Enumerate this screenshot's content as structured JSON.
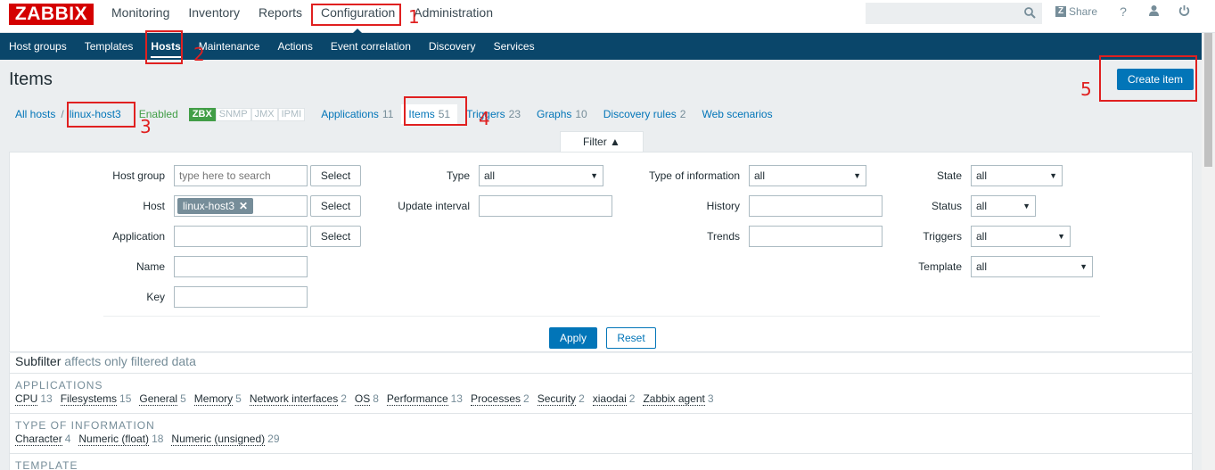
{
  "topbar": {
    "logo": "ZABBIX",
    "nav": [
      "Monitoring",
      "Inventory",
      "Reports",
      "Configuration",
      "Administration"
    ],
    "share": "Share",
    "help": "?",
    "icons": [
      "search-icon",
      "user-icon",
      "power-icon"
    ]
  },
  "subnav": [
    "Host groups",
    "Templates",
    "Hosts",
    "Maintenance",
    "Actions",
    "Event correlation",
    "Discovery",
    "Services"
  ],
  "page": {
    "title": "Items",
    "create_button": "Create item"
  },
  "breadcrumb": {
    "all_hosts": "All hosts",
    "separator": "/",
    "host": "linux-host3",
    "status": "Enabled",
    "badges": [
      {
        "label": "ZBX",
        "active": true
      },
      {
        "label": "SNMP",
        "active": false
      },
      {
        "label": "JMX",
        "active": false
      },
      {
        "label": "IPMI",
        "active": false
      }
    ],
    "tabs": [
      {
        "label": "Applications",
        "count": "11"
      },
      {
        "label": "Items",
        "count": "51"
      },
      {
        "label": "Triggers",
        "count": "23"
      },
      {
        "label": "Graphs",
        "count": "10"
      },
      {
        "label": "Discovery rules",
        "count": "2"
      },
      {
        "label": "Web scenarios",
        "count": ""
      }
    ]
  },
  "filter": {
    "tab_label": "Filter ▲",
    "host_group_label": "Host group",
    "host_group_placeholder": "type here to search",
    "host_label": "Host",
    "host_chip": "linux-host3",
    "application_label": "Application",
    "name_label": "Name",
    "key_label": "Key",
    "select_label": "Select",
    "type_label": "Type",
    "type_value": "all",
    "update_interval_label": "Update interval",
    "type_info_label": "Type of information",
    "type_info_value": "all",
    "history_label": "History",
    "trends_label": "Trends",
    "state_label": "State",
    "state_value": "all",
    "status_label": "Status",
    "status_value": "all",
    "triggers_label": "Triggers",
    "triggers_value": "all",
    "template_label": "Template",
    "template_value": "all",
    "apply": "Apply",
    "reset": "Reset"
  },
  "subfilter": {
    "title": "Subfilter",
    "note": "affects only filtered data",
    "applications": {
      "head": "APPLICATIONS",
      "items": [
        {
          "name": "CPU",
          "count": "13"
        },
        {
          "name": "Filesystems",
          "count": "15"
        },
        {
          "name": "General",
          "count": "5"
        },
        {
          "name": "Memory",
          "count": "5"
        },
        {
          "name": "Network interfaces",
          "count": "2"
        },
        {
          "name": "OS",
          "count": "8"
        },
        {
          "name": "Performance",
          "count": "13"
        },
        {
          "name": "Processes",
          "count": "2"
        },
        {
          "name": "Security",
          "count": "2"
        },
        {
          "name": "xiaodai",
          "count": "2"
        },
        {
          "name": "Zabbix agent",
          "count": "3"
        }
      ]
    },
    "type_of_information": {
      "head": "TYPE OF INFORMATION",
      "items": [
        {
          "name": "Character",
          "count": "4"
        },
        {
          "name": "Numeric (float)",
          "count": "18"
        },
        {
          "name": "Numeric (unsigned)",
          "count": "29"
        }
      ]
    },
    "template": {
      "head": "TEMPLATE"
    }
  },
  "annotations": [
    "1",
    "2",
    "3",
    "4",
    "5"
  ],
  "colors": {
    "brand_red": "#d40000",
    "nav_blue": "#0a466a",
    "link_blue": "#0275b8",
    "enabled_green": "#429e47",
    "annotation_red": "#e02020"
  }
}
